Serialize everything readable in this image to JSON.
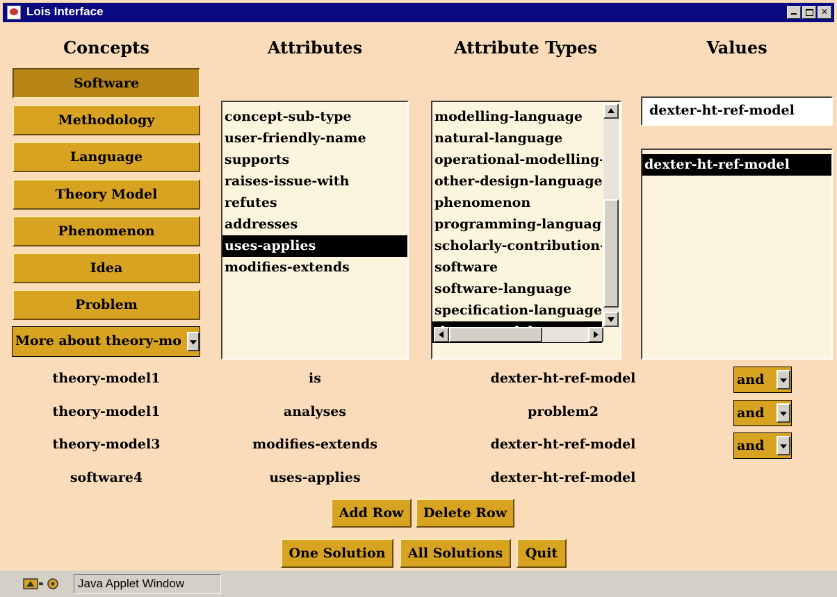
{
  "window": {
    "title": "Lois Interface",
    "controls": [
      "minimize",
      "maximize",
      "close"
    ]
  },
  "headers": {
    "concepts": "Concepts",
    "attributes": "Attributes",
    "attribute_types": "Attribute Types",
    "values": "Values"
  },
  "concepts": {
    "buttons": [
      {
        "label": "Software",
        "active": true
      },
      {
        "label": "Methodology"
      },
      {
        "label": "Language"
      },
      {
        "label": "Theory Model"
      },
      {
        "label": "Phenomenon"
      },
      {
        "label": "Idea"
      },
      {
        "label": "Problem"
      }
    ],
    "more_select": "More about theory-mo"
  },
  "attributes": {
    "items": [
      "concept-sub-type",
      "user-friendly-name",
      "supports",
      "raises-issue-with",
      "refutes",
      "addresses",
      "uses-applies",
      "modifies-extends"
    ],
    "selected": "uses-applies"
  },
  "attribute_types": {
    "items": [
      "modelling-language",
      "natural-language",
      "operational-modelling-",
      "other-design-language",
      "phenomenon",
      "programming-languag",
      "scholarly-contribution-",
      "software",
      "software-language",
      "specification-language",
      "theory-model"
    ],
    "selected": "theory-model"
  },
  "values": {
    "field_value": "dexter-ht-ref-model",
    "items": [
      "dexter-ht-ref-model"
    ],
    "selected": "dexter-ht-ref-model"
  },
  "query_rows": [
    {
      "concept": "theory-model1",
      "attribute": "is",
      "value": "dexter-ht-ref-model",
      "connector": "and"
    },
    {
      "concept": "theory-model1",
      "attribute": "analyses",
      "value": "problem2",
      "connector": "and"
    },
    {
      "concept": "theory-model3",
      "attribute": "modifies-extends",
      "value": "dexter-ht-ref-model",
      "connector": "and"
    },
    {
      "concept": "software4",
      "attribute": "uses-applies",
      "value": "dexter-ht-ref-model"
    }
  ],
  "buttons": {
    "add_row": "Add Row",
    "delete_row": "Delete Row",
    "one_solution": "One Solution",
    "all_solutions": "All Solutions",
    "quit": "Quit"
  },
  "status": {
    "text": "Java Applet Window"
  },
  "colors": {
    "background": "#fadcba",
    "button": "#d8a321",
    "titlebar": "#0a0a80",
    "list_background": "#fcf4dc"
  }
}
